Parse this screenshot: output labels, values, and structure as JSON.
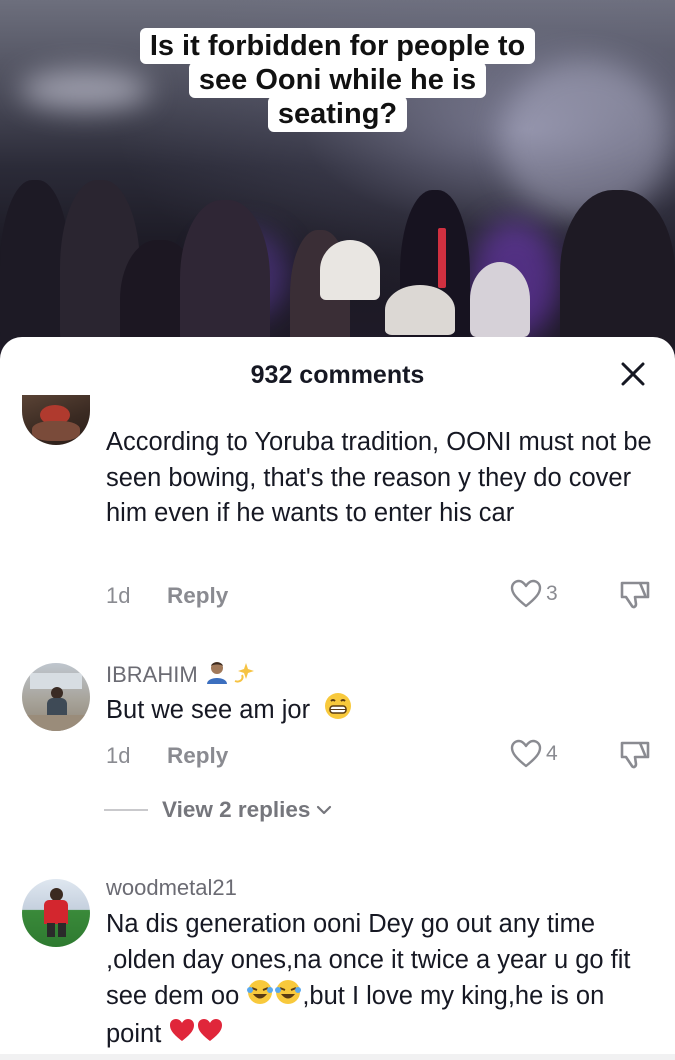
{
  "video": {
    "caption_lines": [
      "Is it forbidden for people to",
      "see Ooni while he is",
      "seating?"
    ]
  },
  "sheet": {
    "comment_count_label": "932 comments",
    "close_icon": "close-icon"
  },
  "comments": [
    {
      "username": "",
      "text": "According to Yoruba tradition, OONI must not be seen bowing, that's the reason y they do cover him even if he wants to enter his car",
      "time": "1d",
      "reply_label": "Reply",
      "likes": "3"
    },
    {
      "username": "IBRAHIM",
      "username_emojis": [
        "man-technologist-emoji",
        "dizzy-emoji"
      ],
      "text": "But we see am jor",
      "text_emoji": "grinning-face-emoji",
      "time": "1d",
      "reply_label": "Reply",
      "likes": "4"
    },
    {
      "username": "woodmetal21",
      "text_parts": [
        "Na dis generation ooni Dey go out any time ,olden day ones,na once it twice a year u go fit see dem oo ",
        ",but I love my king,he is on point "
      ],
      "text_emojis_mid": [
        "rolling-laughing-emoji",
        "rolling-laughing-emoji"
      ],
      "text_emojis_end": [
        "red-heart-emoji",
        "red-heart-emoji"
      ]
    }
  ],
  "view_replies_label": "View 2 replies"
}
